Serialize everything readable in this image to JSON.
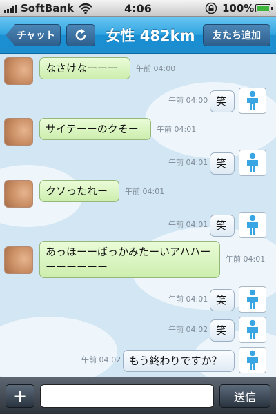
{
  "status_bar": {
    "carrier": "SoftBank",
    "time": "4:06",
    "battery": "100%",
    "battery_level": 1.0,
    "icons": [
      "signal-bars-icon",
      "wifi-icon",
      "rotation-lock-icon",
      "battery-icon"
    ]
  },
  "nav": {
    "back_label": "チャット",
    "title": "女性 482km",
    "add_friend_label": "友たち追加",
    "refresh_icon": "refresh-icon"
  },
  "colors": {
    "nav_blue": "#2ea3e0",
    "incoming_bubble": "#d4f0b8",
    "outgoing_bubble": "#eef4fa",
    "chat_background": "#d3e6f3"
  },
  "messages": [
    {
      "side": "in",
      "text": "なさけなーーー",
      "time": "午前 04:00"
    },
    {
      "side": "out",
      "text": "笑",
      "time": "午前 04:00"
    },
    {
      "side": "in",
      "text": "サイテーーのクそー",
      "time": "午前 04:01"
    },
    {
      "side": "out",
      "text": "笑",
      "time": "午前 04:01"
    },
    {
      "side": "in",
      "text": "クソったれー",
      "time": "午前 04:01"
    },
    {
      "side": "out",
      "text": "笑",
      "time": "午前 04:01"
    },
    {
      "side": "in",
      "text": "あっほーーばっかみたーいアハハーーーーーーー",
      "time": "午前 04:01"
    },
    {
      "side": "out",
      "text": "笑",
      "time": "午前 04:01"
    },
    {
      "side": "out",
      "text": "笑",
      "time": "午前 04:02"
    },
    {
      "side": "out",
      "text": "もう終わりですか？",
      "time": "午前 04:02"
    }
  ],
  "input_bar": {
    "plus_label": "+",
    "message_value": "",
    "message_placeholder": "",
    "send_label": "送信"
  }
}
